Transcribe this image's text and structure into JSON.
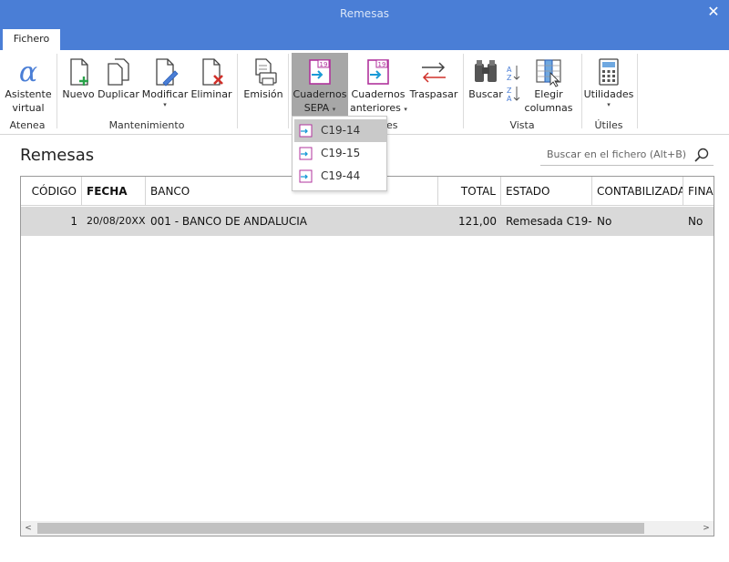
{
  "window": {
    "title": "Remesas",
    "close_glyph": "✕"
  },
  "tabs": [
    {
      "label": "Fichero"
    }
  ],
  "ribbon": {
    "groups": {
      "atenea": "Atenea",
      "mantenimiento": "Mantenimiento",
      "cuadernos": "es",
      "vista": "Vista",
      "utiles": "Útiles"
    },
    "buttons": {
      "asistente": [
        "Asistente",
        "virtual"
      ],
      "nuevo": "Nuevo",
      "duplicar": "Duplicar",
      "modificar": "Modificar",
      "eliminar": "Eliminar",
      "emision": "Emisión",
      "cuadernos_sepa": [
        "Cuadernos",
        "SEPA"
      ],
      "cuadernos_anteriores": [
        "Cuadernos",
        "anteriores"
      ],
      "traspasar": "Traspasar",
      "buscar": "Buscar",
      "elegir_columnas": [
        "Elegir",
        "columnas"
      ],
      "utilidades": "Utilidades"
    },
    "caret": "▾"
  },
  "page": {
    "title": "Remesas"
  },
  "search": {
    "placeholder": "Buscar en el fichero (Alt+B)"
  },
  "table": {
    "columns": [
      "CÓDIGO",
      "FECHA",
      "BANCO",
      "TOTAL",
      "ESTADO",
      "CONTABILIZADA",
      "FINAN"
    ],
    "rows": [
      {
        "codigo": "1",
        "fecha": "20/08/20XX",
        "banco": "001 - BANCO DE ANDALUCIA",
        "total": "121,00",
        "estado": "Remesada C19-...",
        "contabilizada": "No",
        "finan": "No"
      }
    ]
  },
  "scrollbar": {
    "left_arrow": "<",
    "right_arrow": ">"
  },
  "dropdown": {
    "items": [
      {
        "label": "C19-14"
      },
      {
        "label": "C19-15"
      },
      {
        "label": "C19-44"
      }
    ],
    "highlighted": 0
  },
  "colors": {
    "titlebar": "#4a7ed6",
    "active_button": "#a7a7a7",
    "selected_row": "#d9d9d9",
    "accent_magenta": "#b0339c",
    "icon_green": "#2aa34a",
    "icon_red": "#d0302a"
  }
}
